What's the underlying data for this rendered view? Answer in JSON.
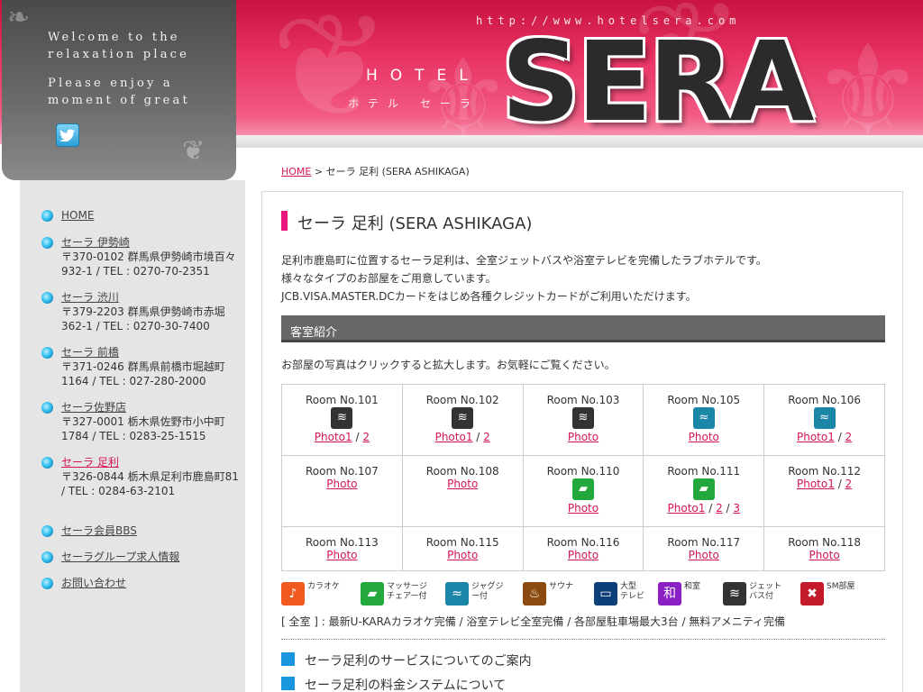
{
  "header": {
    "url": "http://www.hotelsera.com",
    "hotel": "HOTEL",
    "kana": "ホテル セーラ",
    "logo": "SERA"
  },
  "welcome": {
    "line1": "Welcome to the",
    "line2": "relaxation place",
    "line3": "Please enjoy a",
    "line4": "moment of great"
  },
  "sidebar": {
    "home": "HOME",
    "hotels": [
      {
        "name": "セーラ 伊勢崎",
        "addr": "〒370-0102 群馬県伊勢崎市境百々932-1 / TEL : 0270-70-2351"
      },
      {
        "name": "セーラ 渋川",
        "addr": "〒379-2203 群馬県伊勢崎市赤堀362-1 / TEL : 0270-30-7400"
      },
      {
        "name": "セーラ 前橋",
        "addr": "〒371-0246 群馬県前橋市堀越町1164 / TEL : 027-280-2000"
      },
      {
        "name": "セーラ佐野店",
        "addr": "〒327-0001 栃木県佐野市小中町1784 / TEL : 0283-25-1515"
      },
      {
        "name": "セーラ 足利",
        "addr": "〒326-0844 栃木県足利市鹿島町81 / TEL : 0284-63-2101"
      }
    ],
    "links": [
      "セーラ会員BBS",
      "セーラグループ求人情報",
      "お問い合わせ"
    ]
  },
  "breadcrumb": {
    "home": "HOME",
    "current": " > セーラ 足利 (SERA ASHIKAGA)"
  },
  "main": {
    "title": "セーラ 足利 (SERA ASHIKAGA)",
    "desc1": "足利市鹿島町に位置するセーラ足利は、全室ジェットバスや浴室テレビを完備したラブホテルです。",
    "desc2": "様々なタイプのお部屋をご用意しています。",
    "desc3": "JCB.VISA.MASTER.DCカードをはじめ各種クレジットカードがご利用いただけます。",
    "section": "客室紹介",
    "intro": "お部屋の写真はクリックすると拡大します。お気軽にご覧ください。",
    "note": "[ 全室 ] : 最新U-KARAカラオケ完備 / 浴室テレビ全室完備 / 各部屋駐車場最大3台 / 無料アメニティ完備",
    "sub1": "セーラ足利のサービスについてのご案内",
    "sub2": "セーラ足利の料金システムについて"
  },
  "rooms": [
    [
      {
        "name": "Room No.101",
        "icon": "jet",
        "photos": [
          "Photo1",
          "2"
        ]
      },
      {
        "name": "Room No.102",
        "icon": "jet",
        "photos": [
          "Photo1",
          "2"
        ]
      },
      {
        "name": "Room No.103",
        "icon": "jet",
        "photos": [
          "Photo "
        ]
      },
      {
        "name": "Room No.105",
        "icon": "bath",
        "photos": [
          "Photo "
        ]
      },
      {
        "name": "Room No.106",
        "icon": "bath",
        "photos": [
          "Photo1",
          "2"
        ]
      }
    ],
    [
      {
        "name": "Room No.107",
        "icon": "",
        "photos": [
          "Photo "
        ]
      },
      {
        "name": "Room No.108",
        "icon": "",
        "photos": [
          "Photo "
        ]
      },
      {
        "name": "Room No.110",
        "icon": "massage",
        "photos": [
          "Photo "
        ]
      },
      {
        "name": "Room No.111",
        "icon": "massage",
        "photos": [
          "Photo1",
          "2",
          "3"
        ]
      },
      {
        "name": "Room No.112",
        "icon": "",
        "photos": [
          "Photo1",
          "2"
        ]
      }
    ],
    [
      {
        "name": "Room No.113",
        "icon": "",
        "photos": [
          "Photo "
        ]
      },
      {
        "name": "Room No.115",
        "icon": "",
        "photos": [
          "Photo "
        ]
      },
      {
        "name": "Room No.116",
        "icon": "",
        "photos": [
          "Photo "
        ]
      },
      {
        "name": "Room No.117",
        "icon": "",
        "photos": [
          "Photo "
        ]
      },
      {
        "name": "Room No.118",
        "icon": "",
        "photos": [
          "Photo "
        ]
      }
    ]
  ],
  "legend": [
    {
      "l1": "カラオケ",
      "l2": "",
      "color": "#f05a1e",
      "glyph": "♪"
    },
    {
      "l1": "マッサージ",
      "l2": "チェアー付",
      "color": "#22a83d",
      "glyph": "▰"
    },
    {
      "l1": "ジャグジ",
      "l2": "ー付",
      "color": "#1b86a8",
      "glyph": "≈"
    },
    {
      "l1": "サウナ",
      "l2": "",
      "color": "#8a4a10",
      "glyph": "♨"
    },
    {
      "l1": "大型",
      "l2": "テレビ",
      "color": "#0d3f7a",
      "glyph": "▭"
    },
    {
      "l1": "和室",
      "l2": "",
      "color": "#8a1fc4",
      "glyph": "和"
    },
    {
      "l1": "ジェット",
      "l2": "バス付",
      "color": "#333333",
      "glyph": "≋"
    },
    {
      "l1": "SM部屋",
      "l2": "",
      "color": "#c41a2a",
      "glyph": "✖"
    }
  ]
}
